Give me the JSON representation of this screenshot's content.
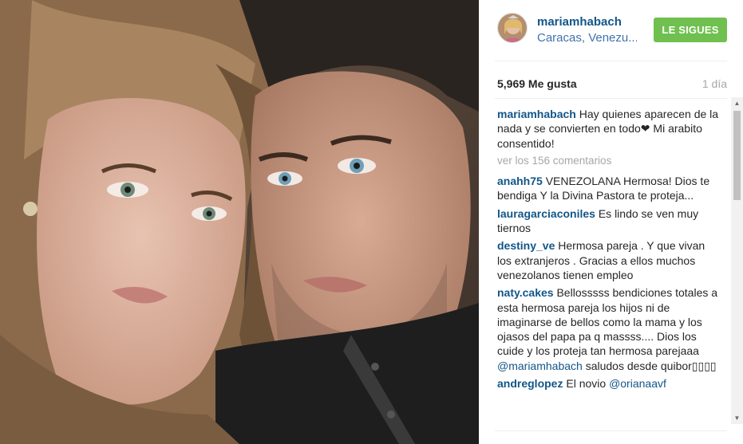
{
  "post": {
    "image_alt": "selfie photo of a couple",
    "header": {
      "username": "mariamhabach",
      "location": "Caracas, Venezu...",
      "follow_label": "LE SIGUES"
    },
    "likes": "5,969 Me gusta",
    "time": "1 día",
    "caption": {
      "user": "mariamhabach",
      "text": " Hay quienes aparecen de la nada y se convierten en todo❤ Mi arabito consentido!"
    },
    "view_all": "ver los 156 comentarios",
    "comments": [
      {
        "user": "anahh75",
        "text": " VENEZOLANA Hermosa! Dios te bendiga Y la Divina Pastora te proteja..."
      },
      {
        "user": "lauragarciaconiles",
        "text": " Es lindo se ven muy tiernos"
      },
      {
        "user": "destiny_ve",
        "text": " Hermosa pareja . Y que vivan los extranjeros . Gracias a ellos muchos venezolanos tienen empleo"
      },
      {
        "user": "naty.cakes",
        "text": " Bellosssss bendiciones totales a esta hermosa pareja los hijos ni de imaginarse de bellos como la mama y los ojasos del papa pa q massss.... Dios los cuide y los proteja tan hermosa parejaaa ",
        "mention": "@mariamhabach",
        "tail": " saludos desde quibor▯▯▯▯"
      },
      {
        "user": "andreglopez",
        "text": " El novio ",
        "mention": "@orianaavf"
      }
    ]
  },
  "colors": {
    "username": "#125688",
    "follow_button": "#70c050",
    "muted": "#a5a7aa"
  },
  "icons": {
    "scroll_up": "triangle-up",
    "scroll_down": "triangle-down"
  }
}
